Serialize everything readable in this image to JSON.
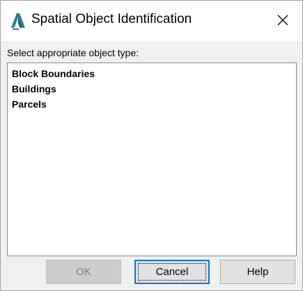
{
  "window": {
    "title": "Spatial Object Identification",
    "close_glyph": "✕",
    "app_icon": "autocad-map-a-icon"
  },
  "prompt": "Select appropriate object type:",
  "list": {
    "items": [
      "Block Boundaries",
      "Buildings",
      "Parcels"
    ]
  },
  "buttons": {
    "ok": "OK",
    "cancel": "Cancel",
    "help": "Help"
  },
  "colors": {
    "accent": "#0078d7",
    "icon_teal": "#2a7f8f",
    "icon_dark": "#1a4f62"
  }
}
